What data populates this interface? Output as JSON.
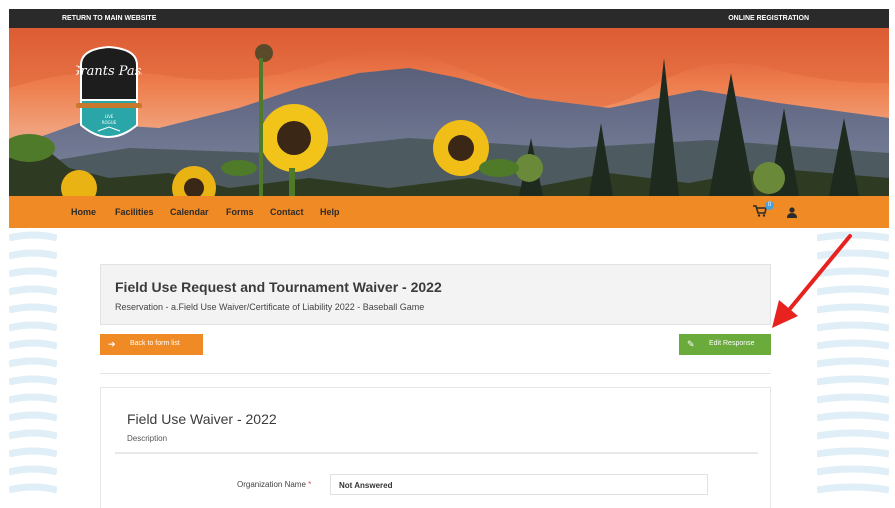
{
  "topbar": {
    "return_label": "RETURN TO MAIN WEBSITE",
    "registration_label": "ONLINE REGISTRATION"
  },
  "logo": {
    "name": "Grants Pass",
    "tagline_line1": "LIVE",
    "tagline_line2": "ROGUE"
  },
  "nav": {
    "items": [
      "Home",
      "Facilities",
      "Calendar",
      "Forms",
      "Contact",
      "Help"
    ],
    "cart_count": "0",
    "accent": "#f08a24"
  },
  "header": {
    "title": "Field Use Request and Tournament Waiver - 2022",
    "subtitle": "Reservation - a.Field Use Waiver/Certificate of Liability 2022 - Baseball Game"
  },
  "actions": {
    "back_label": "Back to form list",
    "edit_label": "Edit Response",
    "back_color": "#f08a24",
    "edit_color": "#6aab3c"
  },
  "form": {
    "title": "Field Use Waiver - 2022",
    "description": "Description",
    "fields": [
      {
        "label": "Organization Name",
        "required_mark": "*",
        "value": "Not Answered"
      }
    ]
  },
  "annotation": {
    "arrow_color": "#e8231f"
  }
}
